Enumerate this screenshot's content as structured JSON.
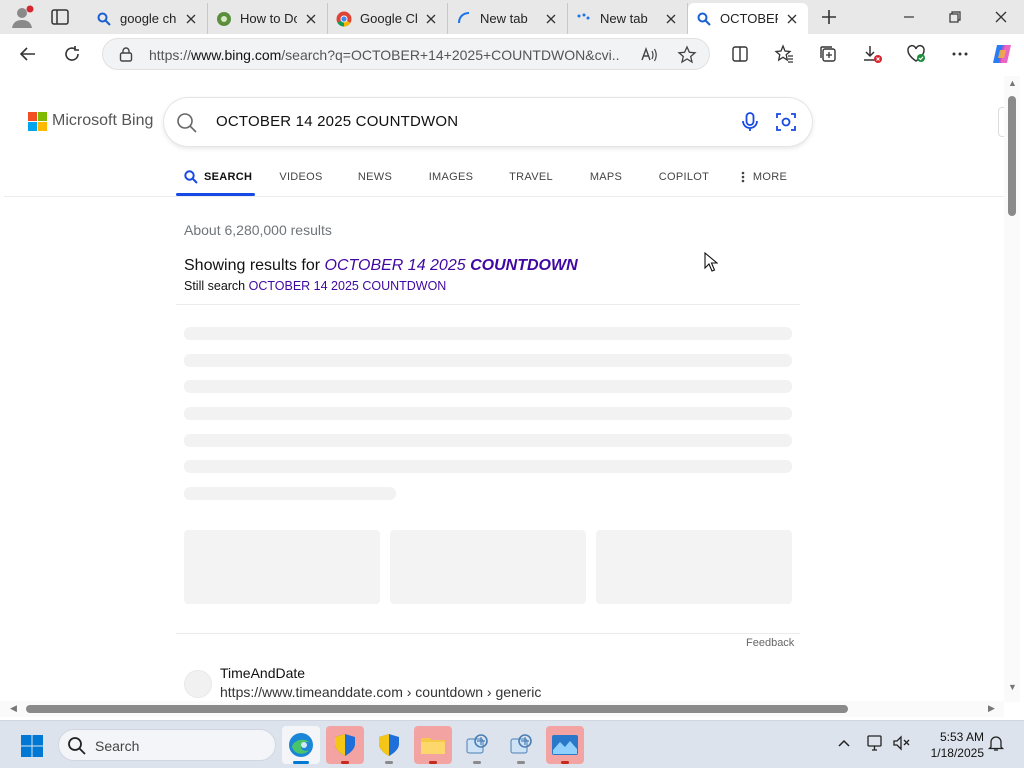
{
  "browser": {
    "tabs": [
      {
        "label": "google chr",
        "icon": "bing-search-icon"
      },
      {
        "label": "How to Do",
        "icon": "site-favicon-icon"
      },
      {
        "label": "Google Ch",
        "icon": "chrome-icon"
      },
      {
        "label": "New tab",
        "icon": "newtab-icon"
      },
      {
        "label": "New tab",
        "icon": "newtab-icon"
      },
      {
        "label": "OCTOBER",
        "icon": "bing-search-icon",
        "active": true
      }
    ],
    "url_prefix": "https://",
    "url_host": "www.bing.com",
    "url_rest": "/search?q=OCTOBER+14+2025+COUNTDWON&cvi..."
  },
  "bing": {
    "logo_text": "Microsoft Bing",
    "query": "OCTOBER 14 2025 COUNTDWON",
    "scopes": [
      "SEARCH",
      "VIDEOS",
      "NEWS",
      "IMAGES",
      "TRAVEL",
      "MAPS",
      "COPILOT",
      "MORE"
    ],
    "result_count": "About 6,280,000 results",
    "showing_prefix": "Showing results for ",
    "corrected_normal": "OCTOBER 14 2025 ",
    "corrected_bold": "COUNTDOWN",
    "still_prefix": "Still search ",
    "still_link": "OCTOBER 14 2025 COUNTDWON",
    "feedback": "Feedback",
    "result": {
      "site": "TimeAndDate",
      "cite": "https://www.timeanddate.com › countdown › generic"
    }
  },
  "taskbar": {
    "search_label": "Search",
    "time": "5:53 AM",
    "date": "1/18/2025"
  },
  "colors": {
    "accent": "#174ae4",
    "link_visited": "#4007a2"
  }
}
